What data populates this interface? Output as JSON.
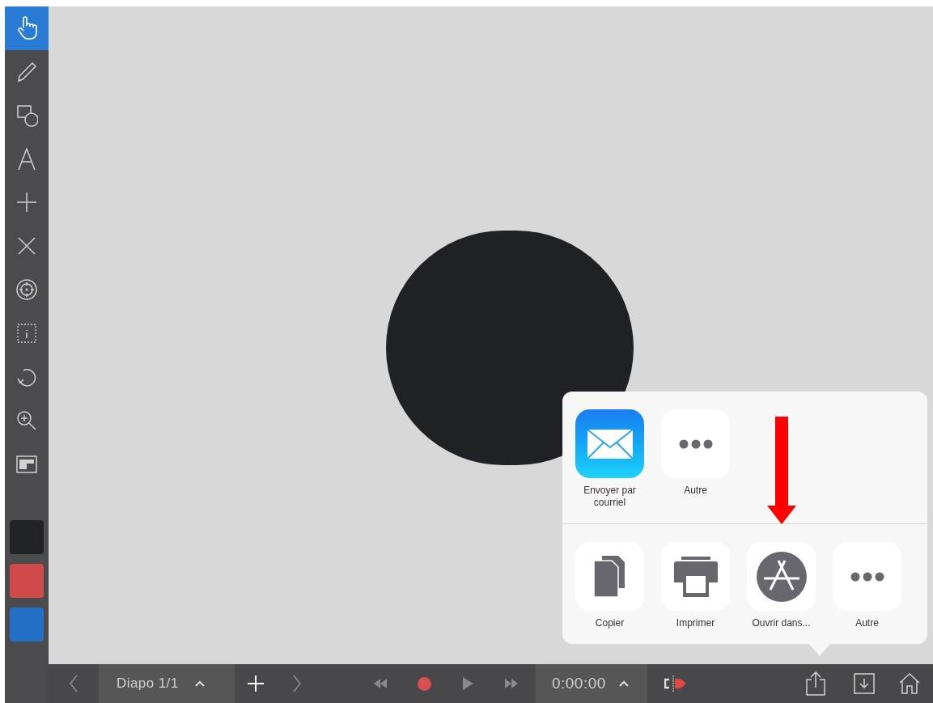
{
  "tools": [
    {
      "kind": "hand",
      "selected": true
    },
    {
      "kind": "pencil",
      "selected": false
    },
    {
      "kind": "shapes",
      "selected": false
    },
    {
      "kind": "text",
      "selected": false
    },
    {
      "kind": "plus",
      "selected": false
    },
    {
      "kind": "cross",
      "selected": false
    },
    {
      "kind": "target",
      "selected": false
    },
    {
      "kind": "info-frame",
      "selected": false
    },
    {
      "kind": "undo",
      "selected": false
    },
    {
      "kind": "zoom",
      "selected": false
    },
    {
      "kind": "window",
      "selected": false
    }
  ],
  "colors": [
    {
      "color": "#222326"
    },
    {
      "color": "#d04a4a"
    },
    {
      "color": "#2370c8"
    }
  ],
  "share_sheet": {
    "apps": [
      {
        "kind": "mail",
        "label": "Envoyer par courriel"
      },
      {
        "kind": "more",
        "label": "Autre"
      }
    ],
    "actions": [
      {
        "kind": "copy",
        "label": "Copier"
      },
      {
        "kind": "print",
        "label": "Imprimer"
      },
      {
        "kind": "appstore",
        "label": "Ouvrir dans..."
      },
      {
        "kind": "more",
        "label": "Autre"
      }
    ]
  },
  "bottom_bar": {
    "slide": "Diapo 1/1",
    "time": "0:00:00"
  }
}
